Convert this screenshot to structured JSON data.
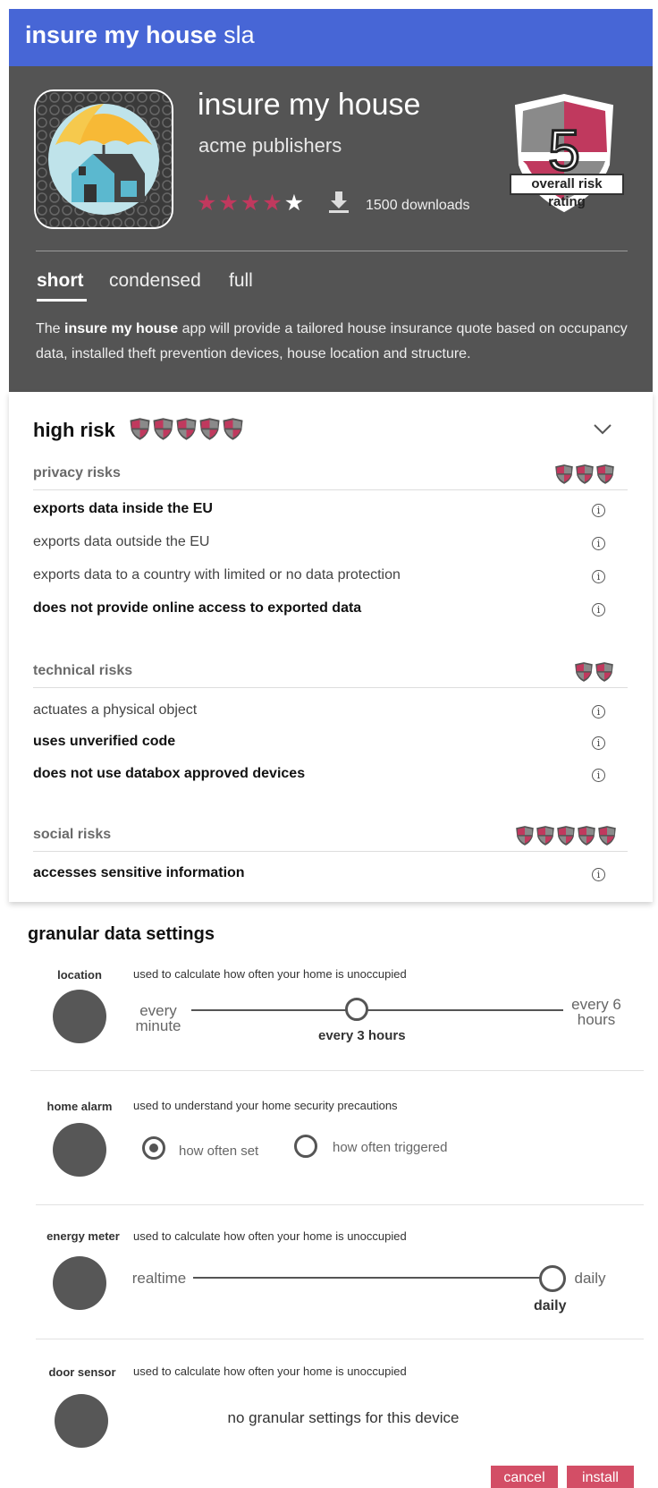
{
  "topbar": {
    "title_bold": "insure my house",
    "title_rest": " sla"
  },
  "app": {
    "name": "insure my house",
    "publisher": "acme publishers",
    "rating": {
      "filled": 4,
      "total": 5
    },
    "downloads": "1500 downloads",
    "risk_number": "5",
    "risk_label": "overall risk rating"
  },
  "tabs": [
    {
      "label": "short",
      "active": true
    },
    {
      "label": "condensed",
      "active": false
    },
    {
      "label": "full",
      "active": false
    }
  ],
  "description": {
    "prefix": "The ",
    "app_bold": "insure my house",
    "suffix": " app will provide a tailored house insurance quote based on occupancy data, installed theft prevention devices, house location and structure."
  },
  "risk": {
    "level_label": "high risk",
    "level_shields": 5,
    "sections": [
      {
        "title": "privacy risks",
        "shields": 3,
        "items": [
          {
            "text": "exports data inside the EU",
            "bold": true
          },
          {
            "text": "exports data outside the EU",
            "bold": false
          },
          {
            "text": "exports data to a country with limited or no data protection",
            "bold": false
          },
          {
            "text": "does not provide online access to exported data",
            "bold": true
          }
        ]
      },
      {
        "title": "technical risks",
        "shields": 2,
        "items": [
          {
            "text": "actuates a physical object",
            "bold": false
          },
          {
            "text": "uses unverified code",
            "bold": true
          },
          {
            "text": "does not use databox approved devices",
            "bold": true
          }
        ]
      },
      {
        "title": "social risks",
        "shields": 5,
        "items": [
          {
            "text": "accesses sensitive information",
            "bold": true
          }
        ]
      }
    ]
  },
  "granular": {
    "title": "granular data settings",
    "location": {
      "label": "location",
      "desc": "used to calculate how often your home is unoccupied",
      "min_label": "every minute",
      "max_label": "every 6 hours",
      "value": "every 3 hours",
      "position_fraction": 0.44
    },
    "home_alarm": {
      "label": "home alarm",
      "desc": "used to understand your home security precautions",
      "options": [
        "how often set",
        "how often triggered"
      ],
      "selected": "how often set"
    },
    "energy_meter": {
      "label": "energy meter",
      "desc": "used to calculate how often your home is unoccupied",
      "min_label": "realtime",
      "max_label": "daily",
      "value": "daily",
      "position_fraction": 1.0
    },
    "door_sensor": {
      "label": "door sensor",
      "desc": "used to calculate how often your home is unoccupied",
      "note": "no granular settings for this device"
    }
  },
  "buttons": {
    "cancel": "cancel",
    "install": "install"
  },
  "colors": {
    "topbar": "#4766d6",
    "header": "#545454",
    "risk": "#c0395e",
    "button": "#d34e66"
  }
}
